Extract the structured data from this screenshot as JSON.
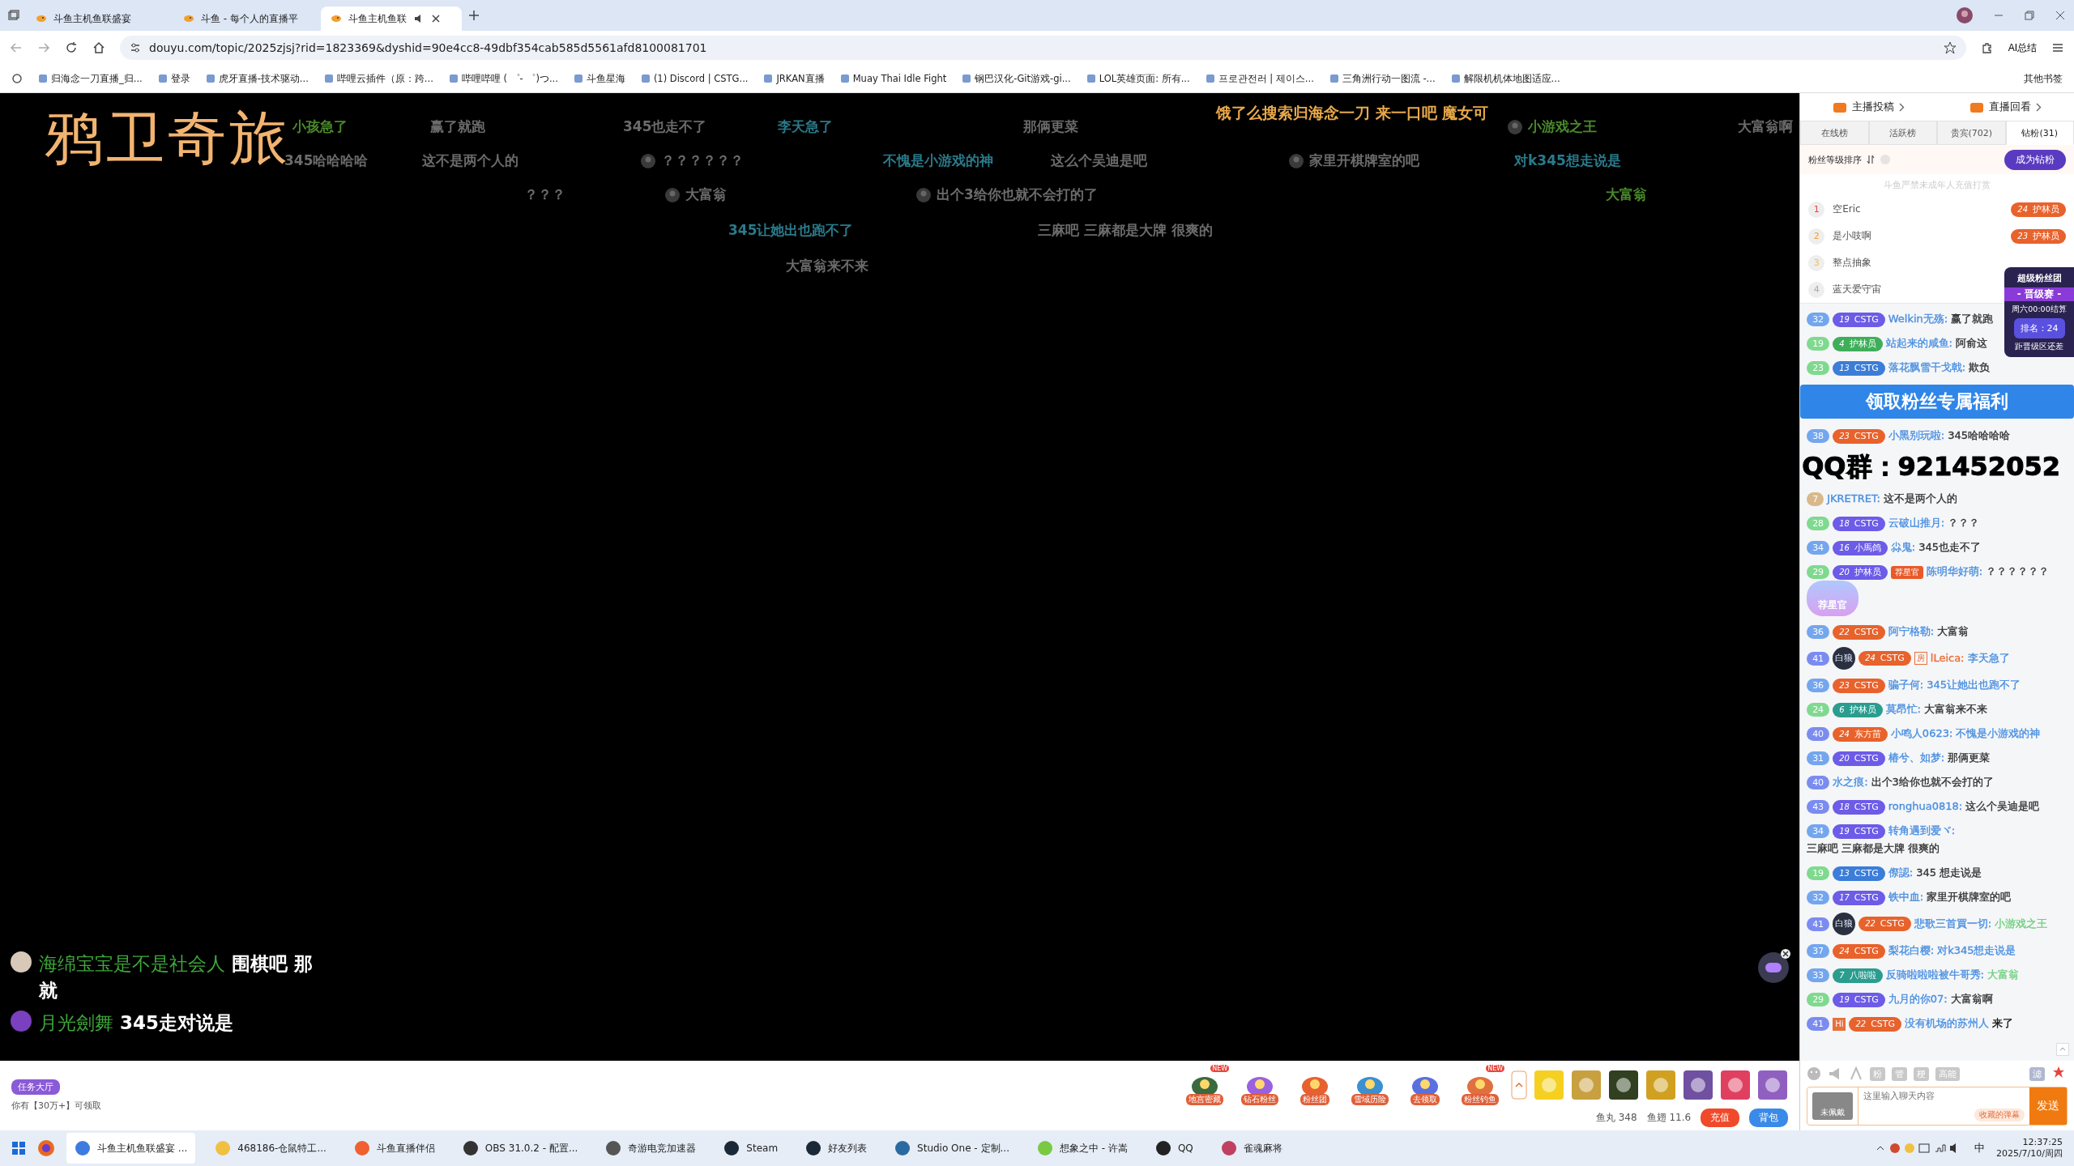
{
  "browser": {
    "tabs": [
      {
        "title": "斗鱼主机鱼联盛宴",
        "selected": false
      },
      {
        "title": "斗鱼 - 每个人的直播平",
        "selected": false
      },
      {
        "title": "斗鱼主机鱼联",
        "selected": true
      }
    ],
    "url": "douyu.com/topic/2025zjsj?rid=1823369&dyshid=90e4cc8-49dbf354cab585d5561afd8100081701",
    "ai_button": "AI总结",
    "bookmarks": [
      "归海念一刀直播_归...",
      "登录",
      "虎牙直播-技术驱动...",
      "哔哩云插件（原：跨...",
      "哔哩哔哩 ( ゜- ゜)つ...",
      "斗鱼星海",
      "(1) Discord | CSTG...",
      "JRKAN直播",
      "Muay Thai Idle Fight",
      "钢巴汉化-Git游戏-gi...",
      "LOL英雄页面: 所有...",
      "프로관전러 | 제이스...",
      "三角洲行动一图流 -...",
      "解限机机体地图适应..."
    ],
    "other_bookmarks": "其他书签"
  },
  "video": {
    "title": "鸦卫奇旅",
    "danmaku": [
      {
        "text": "小孩急了",
        "color": "#4a8a2a",
        "avatar": false
      },
      {
        "text": "赢了就跑",
        "color": "#6b6b6b",
        "avatar": false
      },
      {
        "text": "345也走不了",
        "color": "#6b6b6b",
        "avatar": false
      },
      {
        "text": "李天急了",
        "color": "#2a7a8a",
        "avatar": false
      },
      {
        "text": "那俩更菜",
        "color": "#6b6b6b",
        "avatar": false
      },
      {
        "text": "饿了么搜索归海念一刀 来一口吧 魔女可",
        "color": "#e8a94a",
        "avatar": false
      },
      {
        "text": "小游戏之王",
        "color": "#4a8a2a",
        "avatar": true
      },
      {
        "text": "大富翁啊",
        "color": "#6b6b6b",
        "avatar": false
      },
      {
        "text": "345哈哈哈哈",
        "color": "#6b6b6b",
        "avatar": false
      },
      {
        "text": "这不是两个人的",
        "color": "#6b6b6b",
        "avatar": false
      },
      {
        "text": "？？？？？？",
        "color": "#6b6b6b",
        "avatar": true
      },
      {
        "text": "不愧是小游戏的神",
        "color": "#2a7a8a",
        "avatar": false
      },
      {
        "text": "这么个吴迪是吧",
        "color": "#6b6b6b",
        "avatar": false
      },
      {
        "text": "家里开棋牌室的吧",
        "color": "#6b6b6b",
        "avatar": true
      },
      {
        "text": "对k345想走说是",
        "color": "#2a7a8a",
        "avatar": false
      },
      {
        "text": "？？？",
        "color": "#6b6b6b",
        "avatar": false
      },
      {
        "text": "大富翁",
        "color": "#6b6b6b",
        "avatar": true
      },
      {
        "text": "出个3给你也就不会打的了",
        "color": "#6b6b6b",
        "avatar": true
      },
      {
        "text": "大富翁",
        "color": "#4a8a2a",
        "avatar": false
      },
      {
        "text": "345让她出也跑不了",
        "color": "#2a7a8a",
        "avatar": false
      },
      {
        "text": "三麻吧 三麻都是大牌 很爽的",
        "color": "#6b6b6b",
        "avatar": false
      },
      {
        "text": "大富翁来不来",
        "color": "#6b6b6b",
        "avatar": false
      }
    ],
    "chat_overlay": [
      {
        "name": "海绵宝宝是不是社会人",
        "message": "围棋吧 那就"
      },
      {
        "name": "月光劍舞",
        "message": "345走对说是"
      }
    ]
  },
  "toolbar": {
    "task_hall": "任务大厅",
    "claim_notice": "你有【30万+】可领取",
    "gifts": [
      {
        "label": "地宫密藏",
        "badge": "NEW"
      },
      {
        "label": "钻石粉丝"
      },
      {
        "label": "粉丝团"
      },
      {
        "label": "雪域历险"
      },
      {
        "label": "去领取"
      },
      {
        "label": "粉丝钓鱼",
        "badge": "NEW"
      }
    ],
    "currency": [
      {
        "label": "鱼丸",
        "value": "348"
      },
      {
        "label": "鱼翅",
        "value": "11.6"
      }
    ],
    "recharge": "充值",
    "backpack": "背包"
  },
  "panel": {
    "header_links": [
      "主播投稿",
      "直播回看"
    ],
    "tabs": [
      {
        "label": "在线榜",
        "selected": false
      },
      {
        "label": "活跃榜",
        "selected": false
      },
      {
        "label": "贵宾(702)",
        "selected": false
      },
      {
        "label": "钻粉(31)",
        "selected": true
      }
    ],
    "sort_label": "粉丝等级排序",
    "become_fan": "成为钻粉",
    "notice": "斗鱼严禁未成年人充值打赏",
    "ranking": [
      {
        "rank": "1",
        "color": "#e8453c",
        "name": "空Eric",
        "badge": {
          "rank": "24",
          "name": "护林员",
          "color": "#e8622c"
        }
      },
      {
        "rank": "2",
        "color": "#f0a030",
        "name": "是小吱啊",
        "badge": {
          "rank": "23",
          "name": "护林员",
          "color": "#e8622c"
        }
      },
      {
        "rank": "3",
        "color": "#f0c040",
        "name": "整点抽象"
      },
      {
        "rank": "4",
        "color": "#aaaaaa",
        "name": "蓝天爱守宙"
      }
    ],
    "fan_widget": {
      "title": "超级粉丝团",
      "event": "- 晋级赛 -",
      "settle": "周六00:00结算",
      "standing": "排名：24",
      "gap": "距晋级区还差"
    },
    "chat": [
      {
        "kind": "message",
        "user_level": {
          "text": "32",
          "color": "#74a6ee"
        },
        "badge": {
          "rank": "19",
          "name": "CSTG",
          "color": "#6c5ce7"
        },
        "user": {
          "text": "Welkin无殇:",
          "color": "#4a8fe0"
        },
        "message": {
          "text": "赢了就跑",
          "color": "#333333"
        }
      },
      {
        "kind": "message",
        "user_level": {
          "text": "19",
          "color": "#7fd98f"
        },
        "badge": {
          "rank": "4",
          "name": "护林员",
          "color": "#3fae5a"
        },
        "user": {
          "text": "站起来的咸鱼:",
          "color": "#4a8fe0"
        },
        "message": {
          "text": "阿俞这",
          "color": "#333333"
        }
      },
      {
        "kind": "message",
        "user_level": {
          "text": "23",
          "color": "#7fd98f"
        },
        "badge": {
          "rank": "13",
          "name": "CSTG",
          "color": "#3b7dd8"
        },
        "user": {
          "text": "落花飘雪干戈戟:",
          "color": "#4a8fe0"
        },
        "message": {
          "text": "欺负",
          "color": "#333333"
        }
      },
      {
        "kind": "banner",
        "text": "领取粉丝专属福利"
      },
      {
        "kind": "message",
        "user_level": {
          "text": "38",
          "color": "#74a6ee"
        },
        "badge": {
          "rank": "23",
          "name": "CSTG",
          "color": "#e8622c"
        },
        "user": {
          "text": "小黑别玩啦:",
          "color": "#4a8fe0"
        },
        "message": {
          "text": "345哈哈哈哈",
          "color": "#333333"
        }
      },
      {
        "kind": "qq",
        "text": "QQ群：921452052"
      },
      {
        "kind": "message",
        "user_level": {
          "text": "7",
          "color": "#d9b98a"
        },
        "user": {
          "text": "JKRETRET:",
          "color": "#4a8fe0"
        },
        "message": {
          "text": "这不是两个人的",
          "color": "#333333"
        }
      },
      {
        "kind": "message",
        "user_level": {
          "text": "28",
          "color": "#7fd98f"
        },
        "badge": {
          "rank": "18",
          "name": "CSTG",
          "color": "#6c5ce7"
        },
        "user": {
          "text": "云破山推月:",
          "color": "#4a8fe0"
        },
        "message": {
          "text": "？？？",
          "color": "#333333"
        }
      },
      {
        "kind": "message",
        "user_level": {
          "text": "34",
          "color": "#74a6ee"
        },
        "badge": {
          "rank": "16",
          "name": "小馬鸽",
          "color": "#6c5ce7"
        },
        "user": {
          "text": "尛鬼:",
          "color": "#4a8fe0"
        },
        "message": {
          "text": "345也走不了",
          "color": "#333333"
        }
      },
      {
        "kind": "message",
        "user_level": {
          "text": "29",
          "color": "#7fd98f"
        },
        "badge": {
          "rank": "20",
          "name": "护林员",
          "color": "#6c5ce7"
        },
        "tags": [
          {
            "kind": "star",
            "text": "荐星官"
          }
        ],
        "user": {
          "text": "陈明华好萌:",
          "color": "#4a8fe0"
        },
        "message": {
          "text": "？？？？？？",
          "color": "#333333"
        },
        "sticker": "荐星官"
      },
      {
        "kind": "message",
        "user_level": {
          "text": "36",
          "color": "#74a6ee"
        },
        "badge": {
          "rank": "22",
          "name": "CSTG",
          "color": "#e8622c"
        },
        "user": {
          "text": "阿宁格勒:",
          "color": "#4a8fe0"
        },
        "message": {
          "text": "大富翁",
          "color": "#333333"
        }
      },
      {
        "kind": "message",
        "user_level": {
          "text": "41",
          "color": "#7b8cf0"
        },
        "tags": [
          {
            "kind": "emblem",
            "text": "白狼"
          },
          {
            "kind": "room",
            "text": "房"
          }
        ],
        "badge": {
          "rank": "24",
          "name": "CSTG",
          "color": "#e8622c"
        },
        "user": {
          "text": "lLeica:",
          "color": "#e8703c"
        },
        "message": {
          "text": "李天急了",
          "color": "#4a8fe0"
        }
      },
      {
        "kind": "message",
        "user_level": {
          "text": "36",
          "color": "#74a6ee"
        },
        "badge": {
          "rank": "23",
          "name": "CSTG",
          "color": "#e8622c"
        },
        "user": {
          "text": "骗子何:",
          "color": "#4a8fe0"
        },
        "message": {
          "text": "345让她出也跑不了",
          "color": "#4a8fe0"
        }
      },
      {
        "kind": "message",
        "user_level": {
          "text": "24",
          "color": "#7fd98f"
        },
        "badge": {
          "rank": "6",
          "name": "护林员",
          "color": "#2a9d8f"
        },
        "user": {
          "text": "莫昂忙:",
          "color": "#4a8fe0"
        },
        "message": {
          "text": "大富翁来不来",
          "color": "#333333"
        }
      },
      {
        "kind": "message",
        "user_level": {
          "text": "40",
          "color": "#7b8cf0"
        },
        "badge": {
          "rank": "24",
          "name": "东方苗",
          "color": "#e8622c"
        },
        "user": {
          "text": "小鸣人0623:",
          "color": "#4a8fe0"
        },
        "message": {
          "text": "不愧是小游戏的神",
          "color": "#4a8fe0"
        }
      },
      {
        "kind": "message",
        "user_level": {
          "text": "31",
          "color": "#74a6ee"
        },
        "badge": {
          "rank": "20",
          "name": "CSTG",
          "color": "#6c5ce7"
        },
        "user": {
          "text": "椿兮、如梦:",
          "color": "#4a8fe0"
        },
        "message": {
          "text": "那俩更菜",
          "color": "#333333"
        }
      },
      {
        "kind": "message",
        "user_level": {
          "text": "40",
          "color": "#7b8cf0"
        },
        "user": {
          "text": "水之痕:",
          "color": "#4a8fe0"
        },
        "message": {
          "text": "出个3给你也就不会打的了",
          "color": "#333333"
        }
      },
      {
        "kind": "message",
        "user_level": {
          "text": "43",
          "color": "#7b8cf0"
        },
        "badge": {
          "rank": "18",
          "name": "CSTG",
          "color": "#6c5ce7"
        },
        "user": {
          "text": "ronghua0818:",
          "color": "#4a8fe0"
        },
        "message": {
          "text": "这么个吴迪是吧",
          "color": "#333333"
        }
      },
      {
        "kind": "message",
        "user_level": {
          "text": "34",
          "color": "#74a6ee"
        },
        "badge": {
          "rank": "19",
          "name": "CSTG",
          "color": "#6c5ce7"
        },
        "user": {
          "text": "转角遇到爱ヾ:",
          "color": "#4a8fe0"
        },
        "message": {
          "text": "三麻吧 三麻都是大牌 很爽的",
          "color": "#333333"
        }
      },
      {
        "kind": "message",
        "user_level": {
          "text": "19",
          "color": "#7fd98f"
        },
        "badge": {
          "rank": "13",
          "name": "CSTG",
          "color": "#3b7dd8"
        },
        "user": {
          "text": "傺認:",
          "color": "#4a8fe0"
        },
        "message": {
          "text": "345  想走说是",
          "color": "#333333"
        }
      },
      {
        "kind": "message",
        "user_level": {
          "text": "32",
          "color": "#74a6ee"
        },
        "badge": {
          "rank": "17",
          "name": "CSTG",
          "color": "#6c5ce7"
        },
        "user": {
          "text": "铁中血:",
          "color": "#4a8fe0"
        },
        "message": {
          "text": "家里开棋牌室的吧",
          "color": "#333333"
        }
      },
      {
        "kind": "message",
        "user_level": {
          "text": "41",
          "color": "#7b8cf0"
        },
        "tags": [
          {
            "kind": "emblem",
            "text": "白狼"
          }
        ],
        "badge": {
          "rank": "22",
          "name": "CSTG",
          "color": "#e8622c"
        },
        "user": {
          "text": "悲歌三首買一切:",
          "color": "#4a8fe0"
        },
        "message": {
          "text": "小游戏之王",
          "color": "#6fcf7f"
        }
      },
      {
        "kind": "message",
        "user_level": {
          "text": "37",
          "color": "#74a6ee"
        },
        "badge": {
          "rank": "24",
          "name": "CSTG",
          "color": "#e8622c"
        },
        "user": {
          "text": "梨花白樱:",
          "color": "#4a8fe0"
        },
        "message": {
          "text": "对k345想走说是",
          "color": "#4a8fe0"
        }
      },
      {
        "kind": "message",
        "user_level": {
          "text": "33",
          "color": "#74a6ee"
        },
        "badge": {
          "rank": "7",
          "name": "八啦啦",
          "color": "#2a9d8f"
        },
        "user": {
          "text": "反骑啦啦啦被牛哥秀:",
          "color": "#4a8fe0"
        },
        "message": {
          "text": "大富翁",
          "color": "#6fcf7f"
        }
      },
      {
        "kind": "message",
        "user_level": {
          "text": "29",
          "color": "#7fd98f"
        },
        "badge": {
          "rank": "19",
          "name": "CSTG",
          "color": "#6c5ce7"
        },
        "user": {
          "text": "九月的你07:",
          "color": "#4a8fe0"
        },
        "message": {
          "text": "大富翁啊",
          "color": "#333333"
        }
      },
      {
        "kind": "message",
        "user_level": {
          "text": "41",
          "color": "#7b8cf0"
        },
        "tags": [
          {
            "kind": "hi",
            "text": "Hi"
          }
        ],
        "badge": {
          "rank": "22",
          "name": "CSTG",
          "color": "#e8622c"
        },
        "user": {
          "text": "没有机场的苏州人",
          "color": "#4a8fe0"
        },
        "message": {
          "text": "来了",
          "color": "#111111"
        }
      }
    ],
    "input": {
      "tools": [
        "粉",
        "管",
        "梗",
        "高能"
      ],
      "filter": "滤",
      "wear": "未佩戴",
      "placeholder": "这里输入聊天内容",
      "saved": "收藏的弹幕",
      "send": "发送"
    }
  },
  "taskbar": {
    "apps": [
      {
        "label": "斗鱼主机鱼联盛宴 ...",
        "color": "#3d7be0",
        "selected": true
      },
      {
        "label": "468186-仓鼠特工...",
        "color": "#f0c040",
        "selected": false
      },
      {
        "label": "斗鱼直播伴侣",
        "color": "#f06030",
        "selected": false
      },
      {
        "label": "OBS 31.0.2 - 配置...",
        "color": "#333333",
        "selected": false
      },
      {
        "label": "奇游电竞加速器",
        "color": "#555555",
        "selected": false
      },
      {
        "label": "Steam",
        "color": "#1b2838",
        "selected": false
      },
      {
        "label": "好友列表",
        "color": "#1b2838",
        "selected": false
      },
      {
        "label": "Studio One - 定制...",
        "color": "#2a6aa0",
        "selected": false
      },
      {
        "label": "想象之中 - 许嵩",
        "color": "#7ac943",
        "selected": false
      },
      {
        "label": "QQ",
        "color": "#222222",
        "selected": false
      },
      {
        "label": "雀魂麻将",
        "color": "#c04060",
        "selected": false
      }
    ],
    "ime": "中",
    "time": "12:37:25",
    "date": "2025/7/10/周四"
  }
}
